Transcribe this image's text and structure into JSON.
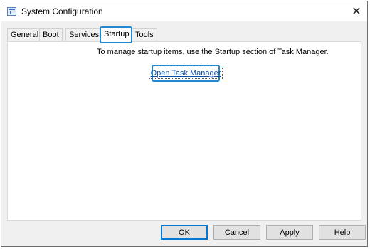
{
  "window": {
    "title": "System Configuration"
  },
  "icons": {
    "app": "settings-window-icon",
    "close": "close-icon"
  },
  "tabs": [
    {
      "label": "General"
    },
    {
      "label": "Boot"
    },
    {
      "label": "Services"
    },
    {
      "label": "Startup",
      "active": true
    },
    {
      "label": "Tools"
    }
  ],
  "startup": {
    "instruction": "To manage startup items, use the Startup section of Task Manager.",
    "link_label": "Open Task Manager"
  },
  "buttons": {
    "ok": "OK",
    "cancel": "Cancel",
    "apply": "Apply",
    "help": "Help"
  },
  "colors": {
    "highlight": "#1f8ad1",
    "link": "#0b4da8"
  }
}
